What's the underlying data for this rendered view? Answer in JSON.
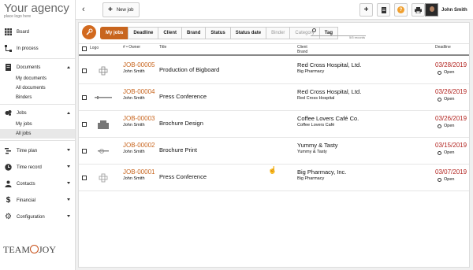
{
  "sidebar": {
    "logo_title": "Your agency",
    "logo_sub": "place logo here",
    "items": [
      {
        "label": "Board",
        "icon": "grid-icon"
      },
      {
        "label": "In process",
        "icon": "flow-icon"
      },
      {
        "label": "Documents",
        "icon": "document-icon"
      },
      {
        "label": "Jobs",
        "icon": "jobs-icon"
      },
      {
        "label": "Time plan",
        "icon": "timeplan-icon"
      },
      {
        "label": "Time record",
        "icon": "clock-icon"
      },
      {
        "label": "Contacts",
        "icon": "contacts-icon"
      },
      {
        "label": "Financial",
        "icon": "dollar-icon"
      },
      {
        "label": "Configuration",
        "icon": "gear-icon"
      }
    ],
    "documents_sub": [
      "My documents",
      "All documents",
      "Binders"
    ],
    "jobs_sub": [
      "My jobs",
      "All jobs"
    ],
    "footer_logo_left": "TEAM",
    "footer_logo_right": "JOY"
  },
  "topbar": {
    "back": "‹",
    "new_job": "New job",
    "user_name": "John Smith"
  },
  "filters": {
    "crumbs": [
      "My jobs",
      "Deadline",
      "Client",
      "Brand",
      "Status",
      "Status date",
      "Binder",
      "Category",
      "Tag"
    ],
    "records": "5/5 records"
  },
  "table": {
    "headers": {
      "logo": "Logo",
      "owner": "# • Owner",
      "title": "Title",
      "client": "Client",
      "brand": "Brand",
      "deadline": "Deadline"
    },
    "rows": [
      {
        "id": "JOB-00005",
        "owner": "John Smith",
        "title": "Production of Bigboard",
        "client": "Red Cross Hospital, Ltd.",
        "brand": "Big Pharmacy",
        "deadline": "03/28/2019",
        "status": "Open"
      },
      {
        "id": "JOB-00004",
        "owner": "John Smith",
        "title": "Press Conference",
        "client": "Red Cross Hospital, Ltd.",
        "brand": "Red Cross Hospital",
        "deadline": "03/26/2019",
        "status": "Open"
      },
      {
        "id": "JOB-00003",
        "owner": "John Smith",
        "title": "Brochure Design",
        "client": "Coffee Lovers Café Co.",
        "brand": "Coffee Lovers Café",
        "deadline": "03/26/2019",
        "status": "Open"
      },
      {
        "id": "JOB-00002",
        "owner": "John Smith",
        "title": "Brochure Print",
        "client": "Yummy & Tasty",
        "brand": "Yummy & Tasty",
        "deadline": "03/15/2019",
        "status": "Open"
      },
      {
        "id": "JOB-00001",
        "owner": "John Smith",
        "title": "Press Conference",
        "client": "Big Pharmacy, Inc.",
        "brand": "Big Pharmacy",
        "deadline": "03/07/2019",
        "status": "Open"
      }
    ]
  },
  "colors": {
    "accent": "#c8651e",
    "deadline": "#b2231f"
  }
}
